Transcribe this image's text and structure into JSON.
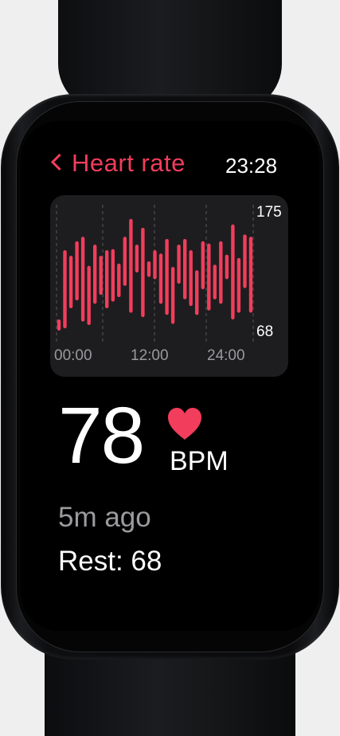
{
  "header": {
    "back_icon": "chevron-left-icon",
    "title": "Heart rate",
    "time": "23:28"
  },
  "chart_data": {
    "type": "bar",
    "title": "",
    "xlabel": "",
    "ylabel": "",
    "x_ticks": [
      "00:00",
      "12:00",
      "24:00"
    ],
    "y_ticks": [
      175,
      68
    ],
    "ylim": [
      68,
      175
    ],
    "grid": "vertical dashed",
    "bar_color": "#f23d5c",
    "series": [
      {
        "values": [
          [
            68,
            78
          ],
          [
            70,
            140
          ],
          [
            88,
            135
          ],
          [
            95,
            148
          ],
          [
            76,
            152
          ],
          [
            73,
            126
          ],
          [
            92,
            145
          ],
          [
            100,
            135
          ],
          [
            88,
            140
          ],
          [
            94,
            141
          ],
          [
            98,
            128
          ],
          [
            108,
            152
          ],
          [
            84,
            168
          ],
          [
            120,
            145
          ],
          [
            80,
            160
          ],
          [
            116,
            130
          ],
          [
            114,
            140
          ],
          [
            92,
            137
          ],
          [
            82,
            150
          ],
          [
            74,
            125
          ],
          [
            110,
            145
          ],
          [
            96,
            150
          ],
          [
            90,
            140
          ],
          [
            82,
            122
          ],
          [
            105,
            148
          ],
          [
            86,
            146
          ],
          [
            96,
            127
          ],
          [
            92,
            148
          ],
          [
            114,
            136
          ],
          [
            78,
            163
          ],
          [
            84,
            133
          ],
          [
            106,
            154
          ],
          [
            84,
            152
          ]
        ]
      }
    ]
  },
  "reading": {
    "value": "78",
    "unit": "BPM",
    "heart_icon": "heart-icon",
    "accent": "#f23d5c",
    "last_seen": "5m ago",
    "resting": "Rest: 68"
  }
}
